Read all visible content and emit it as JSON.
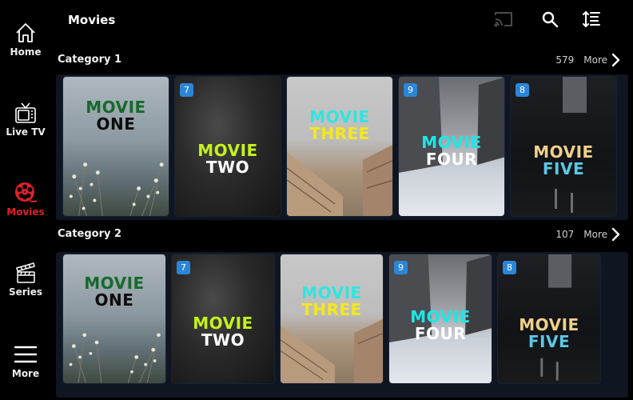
{
  "header": {
    "title": "Movies",
    "icons": [
      "cast-icon",
      "search-icon",
      "sort-icon"
    ]
  },
  "sidebar": {
    "items": [
      {
        "label": "Home",
        "icon": "home-icon",
        "active": false
      },
      {
        "label": "Live TV",
        "icon": "tv-icon",
        "active": false
      },
      {
        "label": "Movies",
        "icon": "film-reel-icon",
        "active": true
      },
      {
        "label": "Series",
        "icon": "clapperboard-icon",
        "active": false
      },
      {
        "label": "More",
        "icon": "menu-icon",
        "active": false
      }
    ],
    "active_color": "#e0202a"
  },
  "categories": [
    {
      "title": "Category 1",
      "count": "579",
      "more_label": "More",
      "movies": [
        {
          "line1": "MOVIE",
          "line2": "ONE",
          "badge": null
        },
        {
          "line1": "MOVIE",
          "line2": "TWO",
          "badge": "7"
        },
        {
          "line1": "MOVIE",
          "line2": "THREE",
          "badge": null
        },
        {
          "line1": "MOVIE",
          "line2": "FOUR",
          "badge": "9"
        },
        {
          "line1": "MOVIE",
          "line2": "FIVE",
          "badge": "8"
        }
      ]
    },
    {
      "title": "Category 2",
      "count": "107",
      "more_label": "More",
      "movies": [
        {
          "line1": "MOVIE",
          "line2": "ONE",
          "badge": null
        },
        {
          "line1": "MOVIE",
          "line2": "TWO",
          "badge": "7"
        },
        {
          "line1": "MOVIE",
          "line2": "THREE",
          "badge": null
        },
        {
          "line1": "MOVIE",
          "line2": "FOUR",
          "badge": "9"
        },
        {
          "line1": "MOVIE",
          "line2": "FIVE",
          "badge": "8"
        }
      ]
    }
  ],
  "colors": {
    "badge": "#2b86d8",
    "row_background": "#0f1622"
  }
}
